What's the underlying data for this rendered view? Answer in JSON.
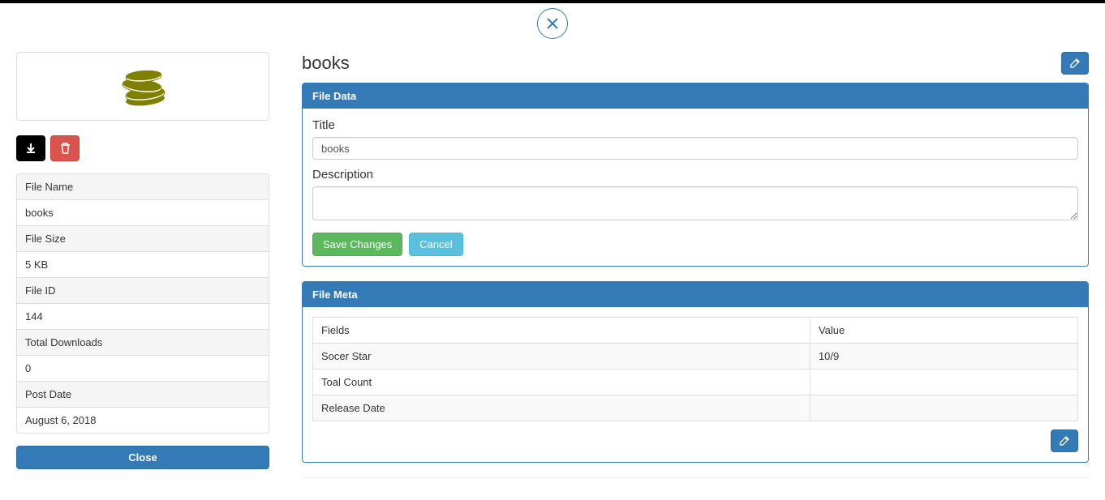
{
  "modal": {
    "close_icon": "×"
  },
  "sidebar": {
    "info": [
      {
        "label": "File Name",
        "value": "books"
      },
      {
        "label": "File Size",
        "value": "5 KB"
      },
      {
        "label": "File ID",
        "value": "144"
      },
      {
        "label": "Total Downloads",
        "value": "0"
      },
      {
        "label": "Post Date",
        "value": "August 6, 2018"
      }
    ],
    "close_label": "Close"
  },
  "main": {
    "title": "books",
    "file_data": {
      "panel_title": "File Data",
      "title_label": "Title",
      "title_value": "books",
      "description_label": "Description",
      "description_value": "",
      "save_label": "Save Changes",
      "cancel_label": "Cancel"
    },
    "file_meta": {
      "panel_title": "File Meta",
      "col_fields": "Fields",
      "col_value": "Value",
      "rows": [
        {
          "field": "Socer Star",
          "value": "10/9"
        },
        {
          "field": "Toal Count",
          "value": ""
        },
        {
          "field": "Release Date",
          "value": ""
        }
      ]
    }
  }
}
